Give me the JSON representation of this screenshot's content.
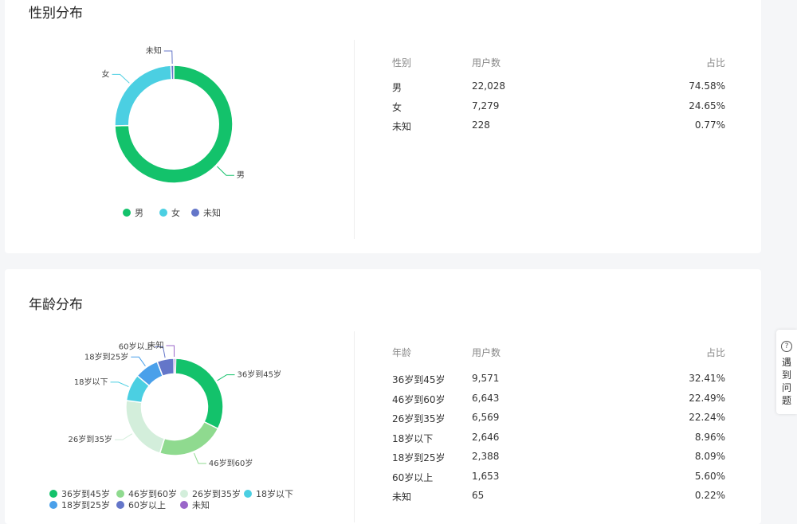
{
  "gender": {
    "title": "性别分布",
    "table_headers": [
      "性别",
      "用户数",
      "占比"
    ],
    "rows": [
      {
        "label": "男",
        "count": "22,028",
        "pct": "74.58%"
      },
      {
        "label": "女",
        "count": "7,279",
        "pct": "24.65%"
      },
      {
        "label": "未知",
        "count": "228",
        "pct": "0.77%"
      }
    ]
  },
  "age": {
    "title": "年龄分布",
    "table_headers": [
      "年龄",
      "用户数",
      "占比"
    ],
    "rows": [
      {
        "label": "36岁到45岁",
        "count": "9,571",
        "pct": "32.41%"
      },
      {
        "label": "46岁到60岁",
        "count": "6,643",
        "pct": "22.49%"
      },
      {
        "label": "26岁到35岁",
        "count": "6,569",
        "pct": "22.24%"
      },
      {
        "label": "18岁以下",
        "count": "2,646",
        "pct": "8.96%"
      },
      {
        "label": "18岁到25岁",
        "count": "2,388",
        "pct": "8.09%"
      },
      {
        "label": "60岁以上",
        "count": "1,653",
        "pct": "5.60%"
      },
      {
        "label": "未知",
        "count": "65",
        "pct": "0.22%"
      }
    ]
  },
  "help": {
    "icon": "question-circle-icon",
    "icon_glyph": "?",
    "label": "遇到问题"
  },
  "chart_data": [
    {
      "type": "pie",
      "title": "性别分布",
      "categories": [
        "男",
        "女",
        "未知"
      ],
      "values": [
        22028,
        7279,
        228
      ],
      "colors": [
        "#13c26b",
        "#4bcfe2",
        "#6476c9"
      ],
      "legend": "bottom"
    },
    {
      "type": "pie",
      "title": "年龄分布",
      "categories": [
        "36岁到45岁",
        "46岁到60岁",
        "26岁到35岁",
        "18岁以下",
        "18岁到25岁",
        "60岁以上",
        "未知"
      ],
      "values": [
        9571,
        6643,
        6569,
        2646,
        2388,
        1653,
        65
      ],
      "colors": [
        "#13c26b",
        "#8fda8f",
        "#d3eedb",
        "#4bcfe2",
        "#4aa0ea",
        "#6476c9",
        "#9a66c9"
      ],
      "legend": "bottom"
    }
  ]
}
